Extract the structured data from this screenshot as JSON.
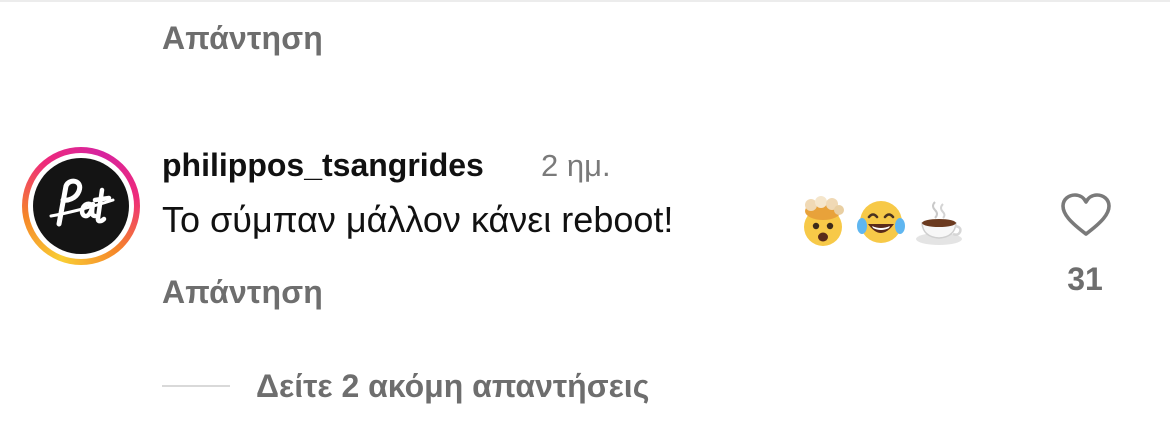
{
  "reply_top": {
    "label": "Απάντηση"
  },
  "comment": {
    "username": "philippos_tsangrides",
    "timestamp": "2 ημ.",
    "text": "Το σύμπαν μάλλον κάνει reboot!",
    "emojis": [
      "exploding-head-emoji",
      "tears-of-joy-emoji",
      "hot-beverage-emoji"
    ],
    "reply_label": "Απάντηση",
    "likes": "31",
    "avatar_logo_text": "Pat"
  },
  "view_more_replies": {
    "label": "Δείτε 2 ακόμη απαντήσεις"
  },
  "colors": {
    "muted_text": "#6e6e6e",
    "story_ring_start": "#f9ce34",
    "story_ring_end": "#d6249f"
  }
}
